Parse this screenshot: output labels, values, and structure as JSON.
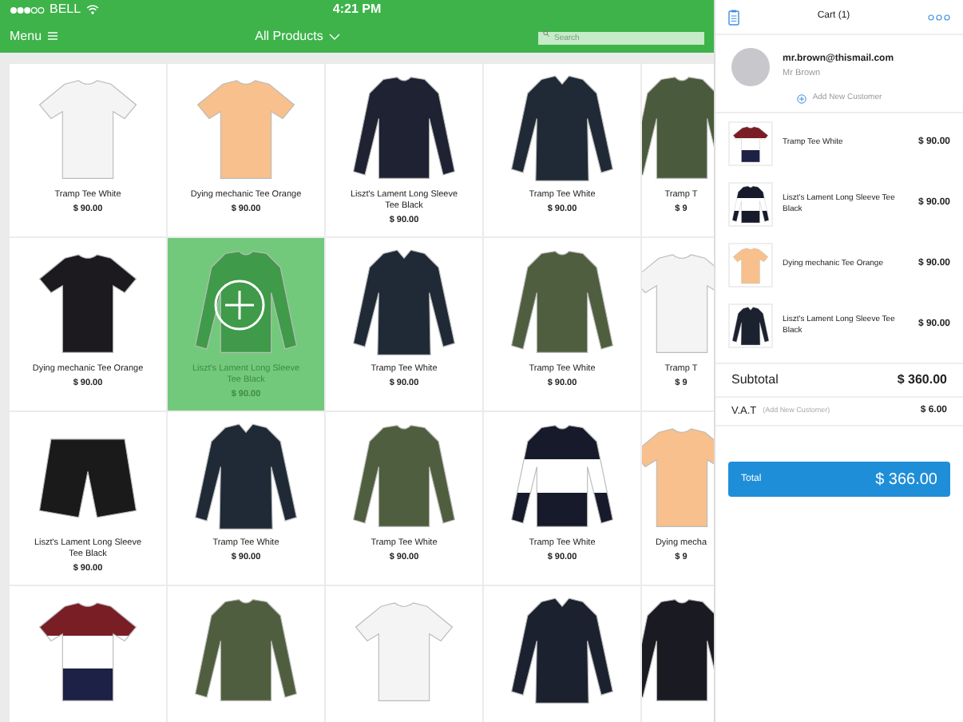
{
  "status_bar": {
    "carrier": "BELL",
    "time": "4:21 PM"
  },
  "nav": {
    "menu": "Menu",
    "title": "All Products",
    "search": {
      "placeholder": "Search"
    }
  },
  "products": [
    {
      "name": "Tramp Tee White",
      "price": "$ 90.00",
      "selected": false,
      "image": {
        "kind": "tee",
        "color": "#f4f4f4"
      }
    },
    {
      "name": "Dying mechanic Tee Orange",
      "price": "$ 90.00",
      "selected": false,
      "image": {
        "kind": "tee",
        "color": "#f7c08c"
      }
    },
    {
      "name": "Liszt's Lament Long Sleeve Tee Black",
      "price": "$ 90.00",
      "selected": false,
      "image": {
        "kind": "longsleeve",
        "color": "#1e2233"
      }
    },
    {
      "name": "Tramp Tee White",
      "price": "$ 90.00",
      "selected": false,
      "image": {
        "kind": "shirt",
        "color": "#1f2a36"
      }
    },
    {
      "name": "Tramp T",
      "price": "$ 9",
      "selected": false,
      "image": {
        "kind": "longsleeve",
        "color": "#4a5a3c"
      }
    },
    {
      "name": "Dying mechanic Tee Orange",
      "price": "$ 90.00",
      "selected": false,
      "image": {
        "kind": "tee",
        "color": "#1c1a1e"
      }
    },
    {
      "name": "Liszt's Lament Long Sleeve Tee Black",
      "price": "$ 90.00",
      "selected": true,
      "image": {
        "kind": "longsleeve",
        "color": "#3f9a49"
      }
    },
    {
      "name": "Tramp Tee White",
      "price": "$ 90.00",
      "selected": false,
      "image": {
        "kind": "shirt",
        "color": "#1f2a36"
      }
    },
    {
      "name": "Tramp Tee White",
      "price": "$ 90.00",
      "selected": false,
      "image": {
        "kind": "longsleeve",
        "color": "#4f5e3e"
      }
    },
    {
      "name": "Tramp T",
      "price": "$ 9",
      "selected": false,
      "image": {
        "kind": "tee",
        "color": "#f4f4f4"
      }
    },
    {
      "name": "Liszt's Lament Long Sleeve Tee Black",
      "price": "$ 90.00",
      "selected": false,
      "image": {
        "kind": "shorts",
        "color": "#1a1a1a"
      }
    },
    {
      "name": "Tramp Tee White",
      "price": "$ 90.00",
      "selected": false,
      "image": {
        "kind": "shirt",
        "color": "#1f2a36"
      }
    },
    {
      "name": "Tramp Tee White",
      "price": "$ 90.00",
      "selected": false,
      "image": {
        "kind": "longsleeve",
        "color": "#4f5e3e"
      }
    },
    {
      "name": "Tramp Tee White",
      "price": "$ 90.00",
      "selected": false,
      "image": {
        "kind": "banded-longsleeve",
        "color": "#161a2a"
      }
    },
    {
      "name": "Dying mecha",
      "price": "$ 9",
      "selected": false,
      "image": {
        "kind": "tee",
        "color": "#f7c08c"
      }
    },
    {
      "selected": false,
      "image": {
        "kind": "banded-tee",
        "color": "#7a1e26"
      }
    },
    {
      "selected": false,
      "image": {
        "kind": "longsleeve",
        "color": "#4f5e3e"
      }
    },
    {
      "selected": false,
      "image": {
        "kind": "tee",
        "color": "#f4f4f4"
      }
    },
    {
      "selected": false,
      "image": {
        "kind": "shirt",
        "color": "#1c2130"
      }
    },
    {
      "selected": false,
      "image": {
        "kind": "longsleeve",
        "color": "#1a1a22"
      }
    }
  ],
  "cart": {
    "title": "Cart (1)",
    "customer": {
      "email": "mr.brown@thismail.com",
      "name": "Mr Brown",
      "add": "Add New Customer"
    },
    "items": [
      {
        "name": "Tramp Tee White",
        "price": "$ 90.00",
        "image": {
          "kind": "banded-tee",
          "color": "#7a1e26"
        }
      },
      {
        "name": "Liszt's Lament Long Sleeve Tee Black",
        "price": "$ 90.00",
        "image": {
          "kind": "banded-longsleeve",
          "color": "#161a2a"
        }
      },
      {
        "name": "Dying mechanic Tee Orange",
        "price": "$ 90.00",
        "image": {
          "kind": "tee",
          "color": "#f7c08c"
        }
      },
      {
        "name": "Liszt's Lament Long Sleeve Tee Black",
        "price": "$ 90.00",
        "image": {
          "kind": "shirt",
          "color": "#1c2130"
        }
      }
    ],
    "subtotal": {
      "label": "Subtotal",
      "value": "$ 360.00"
    },
    "vat": {
      "label": "V.A.T",
      "note": "(Add New Customer)",
      "value": "$ 6.00"
    },
    "total": {
      "label": "Total",
      "value": "$ 366.00"
    }
  }
}
